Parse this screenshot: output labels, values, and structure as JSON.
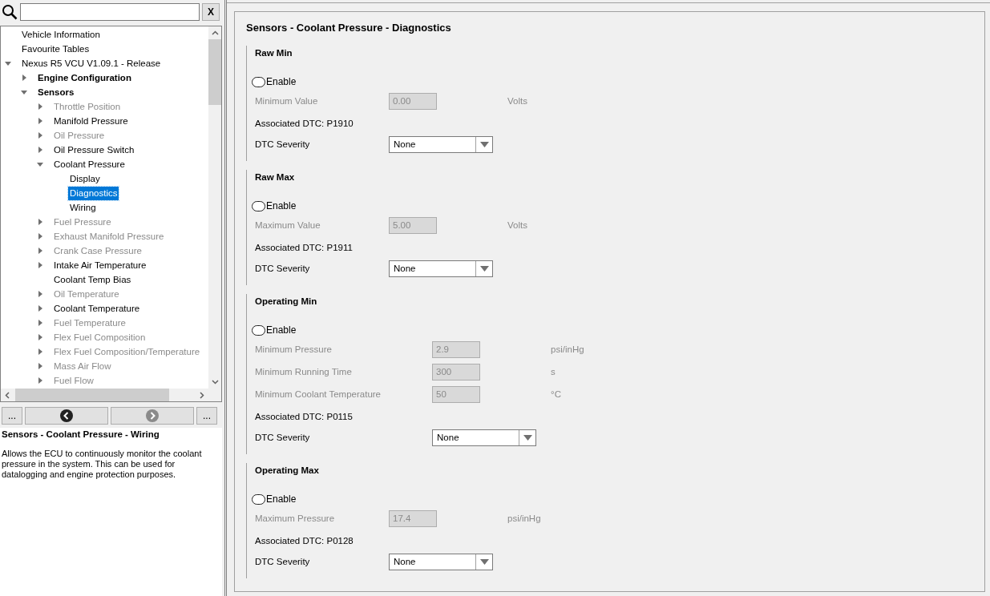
{
  "search": {
    "clear_label": "X"
  },
  "tree": [
    {
      "label": "Vehicle Information",
      "kind": "item",
      "disabled": false,
      "selected": false
    },
    {
      "label": "Favourite Tables",
      "kind": "item",
      "disabled": false,
      "selected": false
    },
    {
      "label": "Nexus R5 VCU V1.09.1 - Release",
      "kind": "item",
      "expanded": true,
      "disabled": false,
      "selected": false,
      "children": [
        {
          "label": "Engine Configuration",
          "kind": "category",
          "expanded": false,
          "disabled": false,
          "selected": false
        },
        {
          "label": "Sensors",
          "kind": "category",
          "expanded": true,
          "disabled": false,
          "selected": false,
          "children": [
            {
              "label": "Throttle Position",
              "kind": "item",
              "expanded": false,
              "disabled": true,
              "selected": false
            },
            {
              "label": "Manifold Pressure",
              "kind": "item",
              "expanded": false,
              "disabled": false,
              "selected": false
            },
            {
              "label": "Oil Pressure",
              "kind": "item",
              "expanded": false,
              "disabled": true,
              "selected": false
            },
            {
              "label": "Oil Pressure Switch",
              "kind": "item",
              "expanded": false,
              "disabled": false,
              "selected": false
            },
            {
              "label": "Coolant Pressure",
              "kind": "item",
              "expanded": true,
              "disabled": false,
              "selected": false,
              "children": [
                {
                  "label": "Display",
                  "kind": "item",
                  "disabled": false,
                  "selected": false
                },
                {
                  "label": "Diagnostics",
                  "kind": "item",
                  "disabled": false,
                  "selected": true
                },
                {
                  "label": "Wiring",
                  "kind": "item",
                  "disabled": false,
                  "selected": false
                }
              ]
            },
            {
              "label": "Fuel Pressure",
              "kind": "item",
              "expanded": false,
              "disabled": true,
              "selected": false
            },
            {
              "label": "Exhaust Manifold Pressure",
              "kind": "item",
              "expanded": false,
              "disabled": true,
              "selected": false
            },
            {
              "label": "Crank Case Pressure",
              "kind": "item",
              "expanded": false,
              "disabled": true,
              "selected": false
            },
            {
              "label": "Intake Air Temperature",
              "kind": "item",
              "expanded": false,
              "disabled": false,
              "selected": false
            },
            {
              "label": "Coolant Temp Bias",
              "kind": "item",
              "disabled": false,
              "selected": false
            },
            {
              "label": "Oil Temperature",
              "kind": "item",
              "expanded": false,
              "disabled": true,
              "selected": false
            },
            {
              "label": "Coolant Temperature",
              "kind": "item",
              "expanded": false,
              "disabled": false,
              "selected": false
            },
            {
              "label": "Fuel Temperature",
              "kind": "item",
              "expanded": false,
              "disabled": true,
              "selected": false
            },
            {
              "label": "Flex Fuel Composition",
              "kind": "item",
              "expanded": false,
              "disabled": true,
              "selected": false
            },
            {
              "label": "Flex Fuel Composition/Temperature",
              "kind": "item",
              "expanded": false,
              "disabled": true,
              "selected": false
            },
            {
              "label": "Mass Air Flow",
              "kind": "item",
              "expanded": false,
              "disabled": true,
              "selected": false
            },
            {
              "label": "Fuel Flow",
              "kind": "item",
              "expanded": false,
              "disabled": true,
              "selected": false
            }
          ]
        }
      ]
    }
  ],
  "nav": {
    "left_more": "...",
    "right_more": "...",
    "back_disabled": false,
    "forward_disabled": true
  },
  "description": {
    "title": "Sensors - Coolant Pressure - Wiring",
    "text": "Allows the ECU to continuously monitor the coolant pressure in the system. This can be used for datalogging and engine protection purposes."
  },
  "page": {
    "title": "Sensors - Coolant Pressure - Diagnostics",
    "sections": [
      {
        "title": "Raw Min",
        "enable": {
          "label": "Enable",
          "checked": false
        },
        "fields": [
          {
            "label": "Minimum Value",
            "value": "0.00",
            "unit": "Volts",
            "disabled": true
          }
        ],
        "dtc": "Associated DTC: P1910",
        "severity": {
          "label": "DTC Severity",
          "value": "None"
        }
      },
      {
        "title": "Raw Max",
        "enable": {
          "label": "Enable",
          "checked": false
        },
        "fields": [
          {
            "label": "Maximum Value",
            "value": "5.00",
            "unit": "Volts",
            "disabled": true
          }
        ],
        "dtc": "Associated DTC: P1911",
        "severity": {
          "label": "DTC Severity",
          "value": "None"
        }
      },
      {
        "title": "Operating Min",
        "enable": {
          "label": "Enable",
          "checked": false
        },
        "fields": [
          {
            "label": "Minimum Pressure",
            "value": "2.9",
            "unit": "psi/inHg",
            "disabled": true
          },
          {
            "label": "Minimum Running Time",
            "value": "300",
            "unit": "s",
            "disabled": true
          },
          {
            "label": "Minimum Coolant Temperature",
            "value": "50",
            "unit": "°C",
            "disabled": true
          }
        ],
        "dtc": "Associated DTC: P0115",
        "severity": {
          "label": "DTC Severity",
          "value": "None"
        }
      },
      {
        "title": "Operating Max",
        "enable": {
          "label": "Enable",
          "checked": false
        },
        "fields": [
          {
            "label": "Maximum Pressure",
            "value": "17.4",
            "unit": "psi/inHg",
            "disabled": true
          }
        ],
        "dtc": "Associated DTC: P0128",
        "severity": {
          "label": "DTC Severity",
          "value": "None"
        }
      }
    ]
  }
}
